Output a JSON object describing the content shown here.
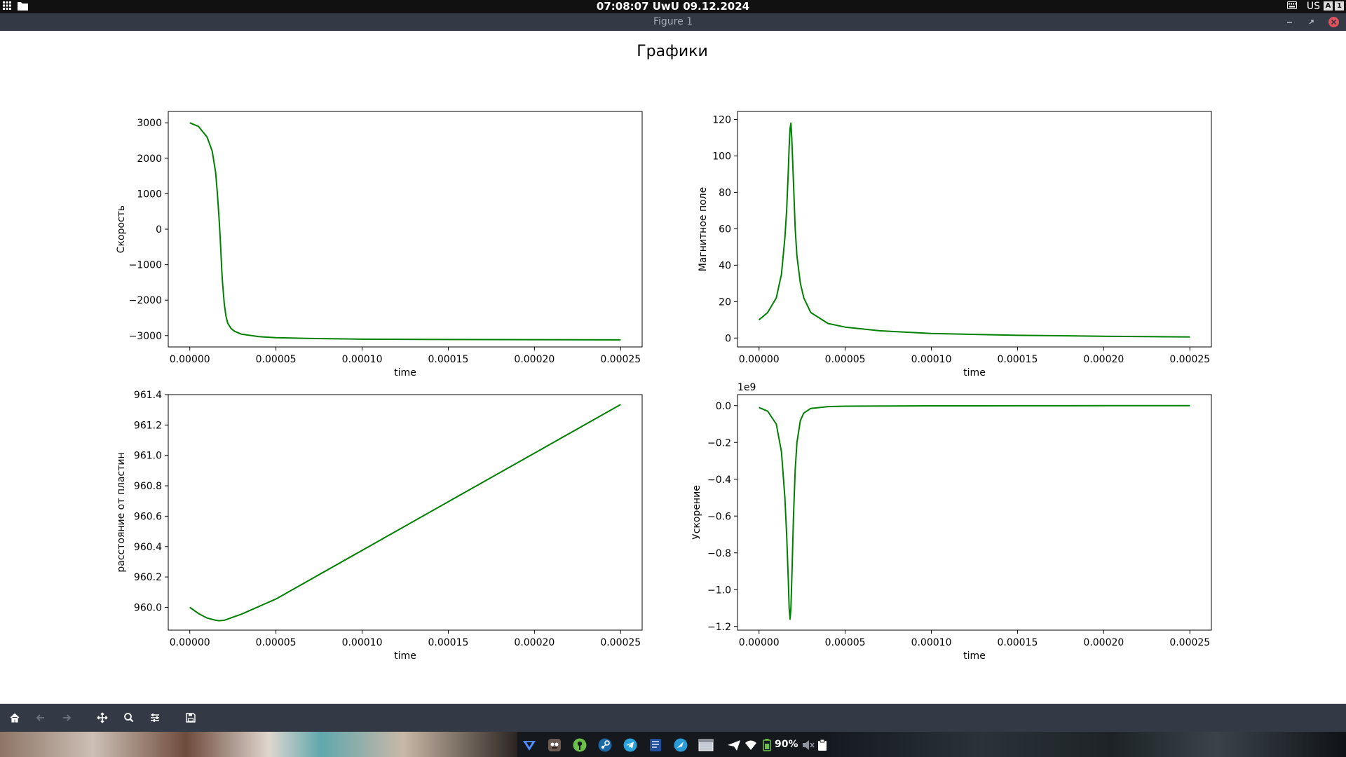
{
  "topbar": {
    "clock": "07:08:07 UwU 09.12.2024",
    "keyboard_layout": "US",
    "indicator_a": "A",
    "indicator_b": "1"
  },
  "window": {
    "title": "Figure 1"
  },
  "figure": {
    "suptitle": "Графики"
  },
  "chart_data": [
    {
      "type": "line",
      "title": "",
      "xlabel": "time",
      "ylabel": "Скорость",
      "color": "#008000",
      "xlim": [
        -1.25e-05,
        0.0002625
      ],
      "ylim": [
        -3320,
        3320
      ],
      "xticks": [
        0,
        5e-05,
        0.0001,
        0.00015,
        0.0002,
        0.00025
      ],
      "xtick_labels": [
        "0.00000",
        "0.00005",
        "0.00010",
        "0.00015",
        "0.00020",
        "0.00025"
      ],
      "yticks": [
        -3000,
        -2000,
        -1000,
        0,
        1000,
        2000,
        3000
      ],
      "ytick_labels": [
        "−3000",
        "−2000",
        "−1000",
        "0",
        "1000",
        "2000",
        "3000"
      ],
      "offset_text": "",
      "series": [
        {
          "x": [
            0,
            5e-06,
            1e-05,
            1.3e-05,
            1.5e-05,
            1.6e-05,
            1.7e-05,
            1.75e-05,
            1.8e-05,
            1.85e-05,
            1.9e-05,
            2e-05,
            2.1e-05,
            2.2e-05,
            2.4e-05,
            2.6e-05,
            3e-05,
            4e-05,
            5e-05,
            7e-05,
            0.0001,
            0.00015,
            0.0002,
            0.00025
          ],
          "y": [
            3000,
            2900,
            2600,
            2200,
            1600,
            1000,
            300,
            -100,
            -600,
            -1100,
            -1500,
            -2100,
            -2450,
            -2650,
            -2800,
            -2880,
            -2960,
            -3030,
            -3060,
            -3080,
            -3100,
            -3110,
            -3115,
            -3120
          ]
        }
      ]
    },
    {
      "type": "line",
      "title": "",
      "xlabel": "time",
      "ylabel": "Магнитное поле",
      "color": "#008000",
      "xlim": [
        -1.25e-05,
        0.0002625
      ],
      "ylim": [
        -4.9,
        124.4
      ],
      "xticks": [
        0,
        5e-05,
        0.0001,
        0.00015,
        0.0002,
        0.00025
      ],
      "xtick_labels": [
        "0.00000",
        "0.00005",
        "0.00010",
        "0.00015",
        "0.00020",
        "0.00025"
      ],
      "yticks": [
        0,
        20,
        40,
        60,
        80,
        100,
        120
      ],
      "ytick_labels": [
        "0",
        "20",
        "40",
        "60",
        "80",
        "100",
        "120"
      ],
      "offset_text": "",
      "series": [
        {
          "x": [
            0,
            5e-06,
            1e-05,
            1.3e-05,
            1.5e-05,
            1.6e-05,
            1.7e-05,
            1.75e-05,
            1.8e-05,
            1.85e-05,
            1.9e-05,
            2e-05,
            2.1e-05,
            2.2e-05,
            2.4e-05,
            2.6e-05,
            3e-05,
            4e-05,
            5e-05,
            7e-05,
            0.0001,
            0.00015,
            0.0002,
            0.00025
          ],
          "y": [
            10,
            14,
            22,
            35,
            55,
            70,
            92,
            105,
            115,
            118,
            110,
            85,
            60,
            45,
            30,
            22,
            14,
            8,
            6,
            4,
            2.5,
            1.5,
            1,
            0.6
          ]
        }
      ]
    },
    {
      "type": "line",
      "title": "",
      "xlabel": "time",
      "ylabel": "расстояние от пластин",
      "color": "#008000",
      "xlim": [
        -1.25e-05,
        0.0002625
      ],
      "ylim": [
        959.85,
        961.4
      ],
      "xticks": [
        0,
        5e-05,
        0.0001,
        0.00015,
        0.0002,
        0.00025
      ],
      "xtick_labels": [
        "0.00000",
        "0.00005",
        "0.00010",
        "0.00015",
        "0.00020",
        "0.00025"
      ],
      "yticks": [
        960.0,
        960.2,
        960.4,
        960.6,
        960.8,
        961.0,
        961.2,
        961.4
      ],
      "ytick_labels": [
        "960.0",
        "960.2",
        "960.4",
        "960.6",
        "960.8",
        "961.0",
        "961.2",
        "961.4"
      ],
      "offset_text": "",
      "series": [
        {
          "x": [
            0,
            5e-06,
            1e-05,
            1.5e-05,
            1.7e-05,
            2e-05,
            2.5e-05,
            3e-05,
            5e-05,
            0.0001,
            0.00015,
            0.0002,
            0.00025
          ],
          "y": [
            960.0,
            959.96,
            959.93,
            959.915,
            959.912,
            959.915,
            959.935,
            959.955,
            960.055,
            960.375,
            960.695,
            961.015,
            961.335
          ]
        }
      ]
    },
    {
      "type": "line",
      "title": "",
      "xlabel": "time",
      "ylabel": "Ускорение",
      "color": "#008000",
      "xlim": [
        -1.25e-05,
        0.0002625
      ],
      "ylim": [
        -1.22,
        0.06
      ],
      "xticks": [
        0,
        5e-05,
        0.0001,
        0.00015,
        0.0002,
        0.00025
      ],
      "xtick_labels": [
        "0.00000",
        "0.00005",
        "0.00010",
        "0.00015",
        "0.00020",
        "0.00025"
      ],
      "yticks": [
        -1.2,
        -1.0,
        -0.8,
        -0.6,
        -0.4,
        -0.2,
        0.0
      ],
      "ytick_labels": [
        "−1.2",
        "−1.0",
        "−0.8",
        "−0.6",
        "−0.4",
        "−0.2",
        "0.0"
      ],
      "offset_text": "1e9",
      "series": [
        {
          "x": [
            0,
            5e-06,
            1e-05,
            1.3e-05,
            1.5e-05,
            1.6e-05,
            1.7e-05,
            1.75e-05,
            1.8e-05,
            1.85e-05,
            1.9e-05,
            2e-05,
            2.1e-05,
            2.2e-05,
            2.4e-05,
            2.6e-05,
            3e-05,
            4e-05,
            5e-05,
            7e-05,
            0.0001,
            0.00015,
            0.0002,
            0.00025
          ],
          "y": [
            -0.01,
            -0.03,
            -0.1,
            -0.25,
            -0.5,
            -0.7,
            -0.95,
            -1.1,
            -1.16,
            -1.1,
            -0.95,
            -0.6,
            -0.35,
            -0.2,
            -0.08,
            -0.04,
            -0.015,
            -0.005,
            -0.003,
            -0.002,
            -0.001,
            -0.0005,
            -0.0003,
            -0.0002
          ]
        }
      ]
    }
  ],
  "toolbar": {
    "icons": [
      "home-icon",
      "back-icon",
      "forward-icon",
      "pan-icon",
      "zoom-icon",
      "configure-subplots-icon",
      "save-icon"
    ]
  },
  "taskbar": {
    "battery": "90%"
  }
}
